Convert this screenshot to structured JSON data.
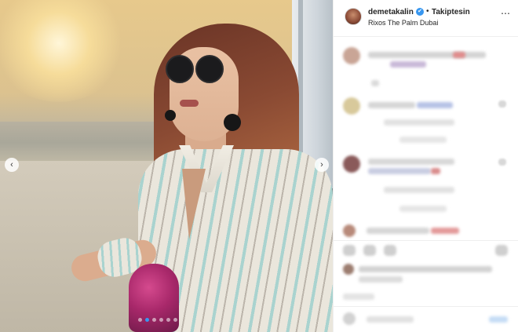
{
  "post": {
    "username": "demetakalin",
    "verified_badge": "✔",
    "separator": "•",
    "follow_label": "Takiptesin",
    "location": "Rixos The Palm Dubai",
    "more_icon": "⋯"
  },
  "carousel": {
    "prev_icon": "‹",
    "next_icon": "›",
    "slide_count": 6,
    "active_slide": 1
  },
  "colors": {
    "accent": "#3897f0",
    "text": "#262626",
    "divider": "#efefef"
  }
}
